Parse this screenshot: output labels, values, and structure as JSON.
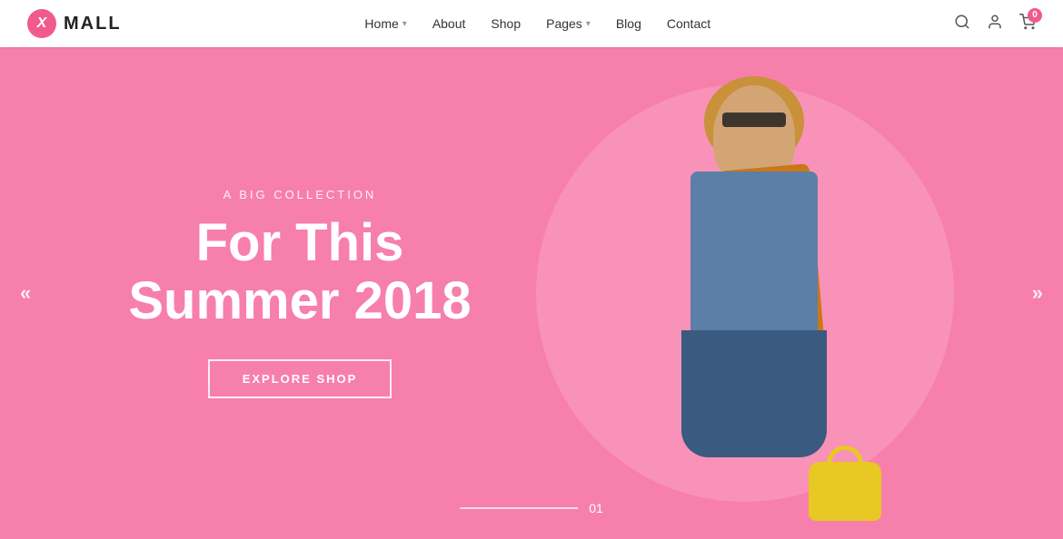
{
  "header": {
    "logo_icon": "X",
    "logo_text": "MALL",
    "nav_items": [
      {
        "label": "Home",
        "has_dropdown": true
      },
      {
        "label": "About",
        "has_dropdown": false
      },
      {
        "label": "Shop",
        "has_dropdown": false
      },
      {
        "label": "Pages",
        "has_dropdown": true
      },
      {
        "label": "Blog",
        "has_dropdown": false
      },
      {
        "label": "Contact",
        "has_dropdown": false
      }
    ],
    "cart_count": "0"
  },
  "hero": {
    "subtitle": "A BIG COLLECTION",
    "title_line1": "For This",
    "title_line2": "Summer 2018",
    "cta_label": "EXPLORE SHOP",
    "slide_number": "01",
    "bg_color": "#f77fac"
  },
  "slider": {
    "prev_icon": "«",
    "next_icon": "»"
  }
}
